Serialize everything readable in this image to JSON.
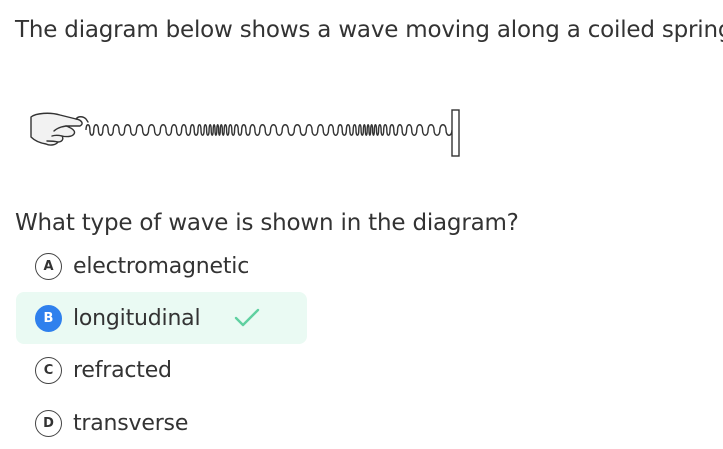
{
  "question": {
    "intro": "The diagram below shows a wave moving along a coiled spring.",
    "prompt": "What type of wave is shown in the diagram?"
  },
  "diagram": {
    "hand_icon": "hand-icon",
    "spring_icon": "coiled-spring-icon",
    "handle_icon": "fixed-end-icon"
  },
  "options": [
    {
      "letter": "A",
      "label": "electromagnetic",
      "state": "default"
    },
    {
      "letter": "B",
      "label": "longitudinal",
      "state": "correct-selected"
    },
    {
      "letter": "C",
      "label": "refracted",
      "state": "default"
    },
    {
      "letter": "D",
      "label": "transverse",
      "state": "default"
    }
  ],
  "colors": {
    "text": "#333333",
    "correct_background": "#eafaf3",
    "selected_badge": "#2f80ed",
    "check": "#5fd0a0"
  },
  "icons": {
    "correct": "check-icon"
  }
}
